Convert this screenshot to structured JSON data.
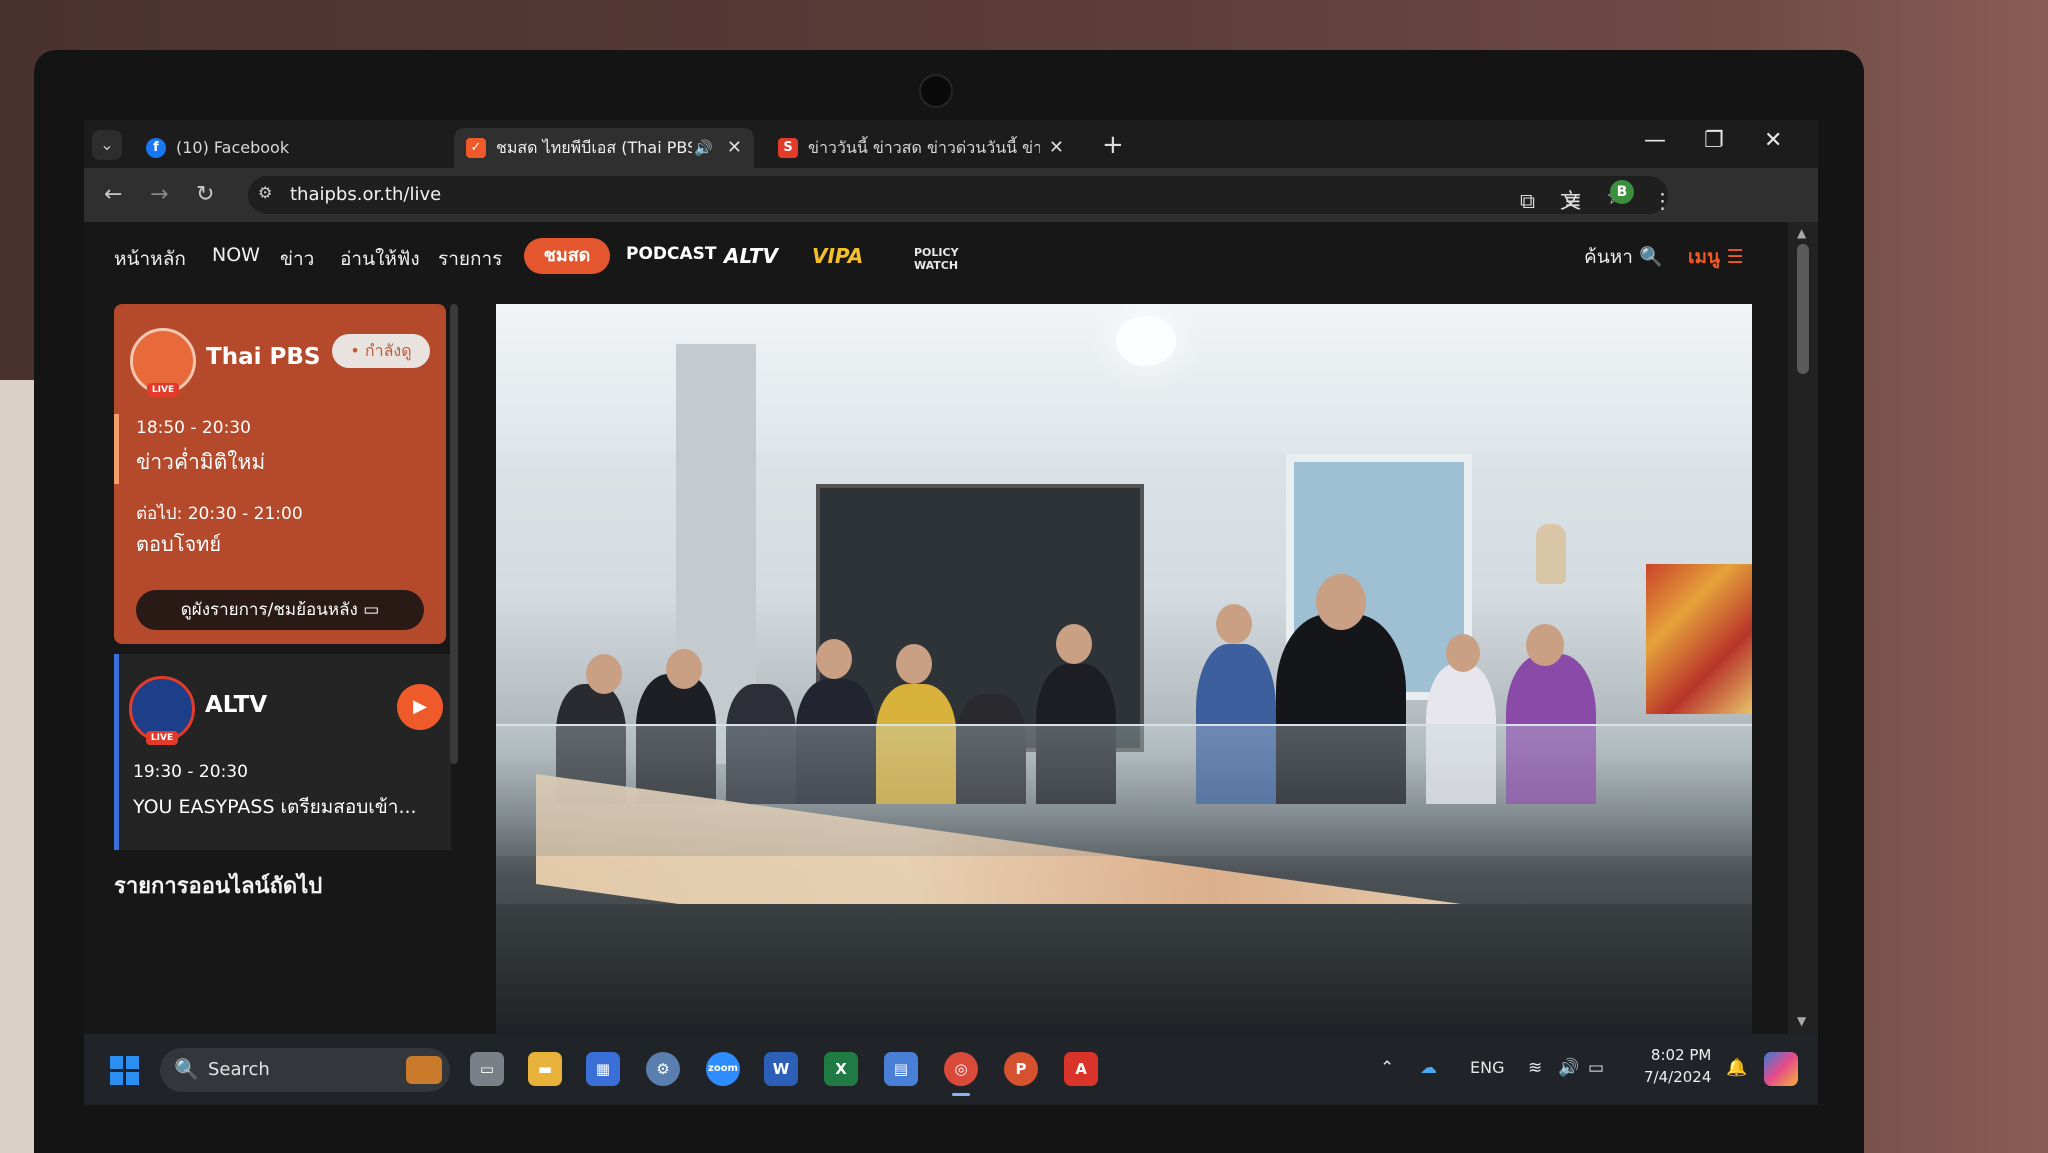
{
  "browser": {
    "tabs": [
      {
        "title": "(10) Facebook",
        "active": false
      },
      {
        "title": "ชมสด ไทยพีบีเอส (Thai PBS Li",
        "active": true
      },
      {
        "title": "ข่าววันนี้ ข่าวสด ข่าวด่วนวันนี้ ข่าวอ",
        "active": false
      }
    ],
    "url": "thaipbs.or.th/live",
    "profile_initial": "B"
  },
  "site_nav": {
    "items": [
      "หน้าหลัก",
      "NOW",
      "ข่าว",
      "อ่านให้ฟัง",
      "รายการ"
    ],
    "live_label": "ชมสด",
    "brands": [
      "PODCAST",
      "ALTV",
      "VIPA",
      "POLICY WATCH"
    ],
    "search_label": "ค้นหา",
    "menu_label": "เมนู"
  },
  "channels": {
    "thaipbs": {
      "name": "Thai PBS",
      "live_badge": "LIVE",
      "status": "• กำลังดู",
      "time": "18:50 - 20:30",
      "program": "ข่าวค่ำมิติใหม่",
      "next_time": "ต่อไป: 20:30 - 21:00",
      "next_program": "ตอบโจทย์",
      "schedule_button": "ดูผังรายการ/ชมย้อนหลัง"
    },
    "altv": {
      "name": "ALTV",
      "live_badge": "LIVE",
      "time": "19:30 - 20:30",
      "program": "YOU EASYPASS เตรียมสอบเข้า..."
    }
  },
  "upnext_heading": "รายการออนไลน์ถัดไป",
  "taskbar": {
    "search_label": "Search",
    "language": "ENG",
    "time": "8:02 PM",
    "date": "7/4/2024"
  },
  "colors": {
    "accent": "#e4572e",
    "card": "#b5492c",
    "altv_bar": "#3d6fd8"
  }
}
